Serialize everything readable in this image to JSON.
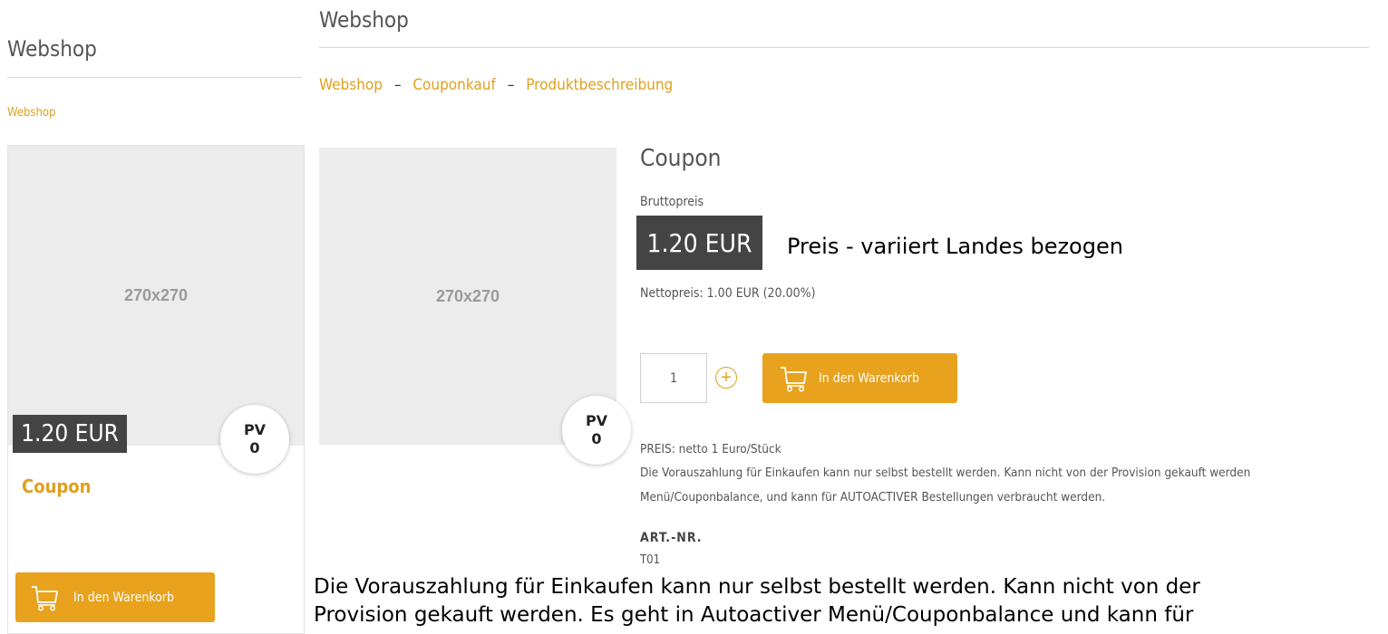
{
  "sidebar": {
    "title": "Webshop",
    "link": "Webshop",
    "card": {
      "image_label": "270x270",
      "price": "1.20 EUR",
      "pv_label": "PV",
      "pv_value": "0",
      "name": "Coupon",
      "cart_button": "In den Warenkorb"
    }
  },
  "main": {
    "title": "Webshop",
    "breadcrumb": [
      "Webshop",
      "Couponkauf",
      "Produktbeschreibung"
    ],
    "breadcrumb_separator": "–",
    "product": {
      "image_label": "270x270",
      "pv_label": "PV",
      "pv_value": "0",
      "name": "Coupon",
      "gross_label": "Bruttopreis",
      "price": "1.20 EUR",
      "price_annotation": "Preis - variiert Landes bezogen",
      "net_price": "Nettopreis: 1.00 EUR (20.00%)",
      "quantity": "1",
      "cart_button": "In den Warenkorb",
      "description_line1": "PREIS: netto 1 Euro/Stück",
      "description_line2": "Die Vorauszahlung für Einkaufen kann nur selbst bestellt werden. Kann nicht von der Provision gekauft werden",
      "description_line3": "Menü/Couponbalance, und kann für AUTOACTIVER Bestellungen verbraucht werden.",
      "article_label": "ART.-NR.",
      "article_value": "T01"
    }
  },
  "overlay_text": {
    "line1": "Die Vorauszahlung für Einkaufen kann nur selbst bestellt werden. Kann nicht von der",
    "line2": "Provision gekauft werden. Es geht in Autoactiver Menü/Couponbalance und kann für"
  },
  "colors": {
    "accent": "#e8a21d",
    "price_bg": "#444444",
    "placeholder_bg": "#ececec"
  },
  "icons": [
    "cart-icon",
    "plus-circle-icon"
  ]
}
